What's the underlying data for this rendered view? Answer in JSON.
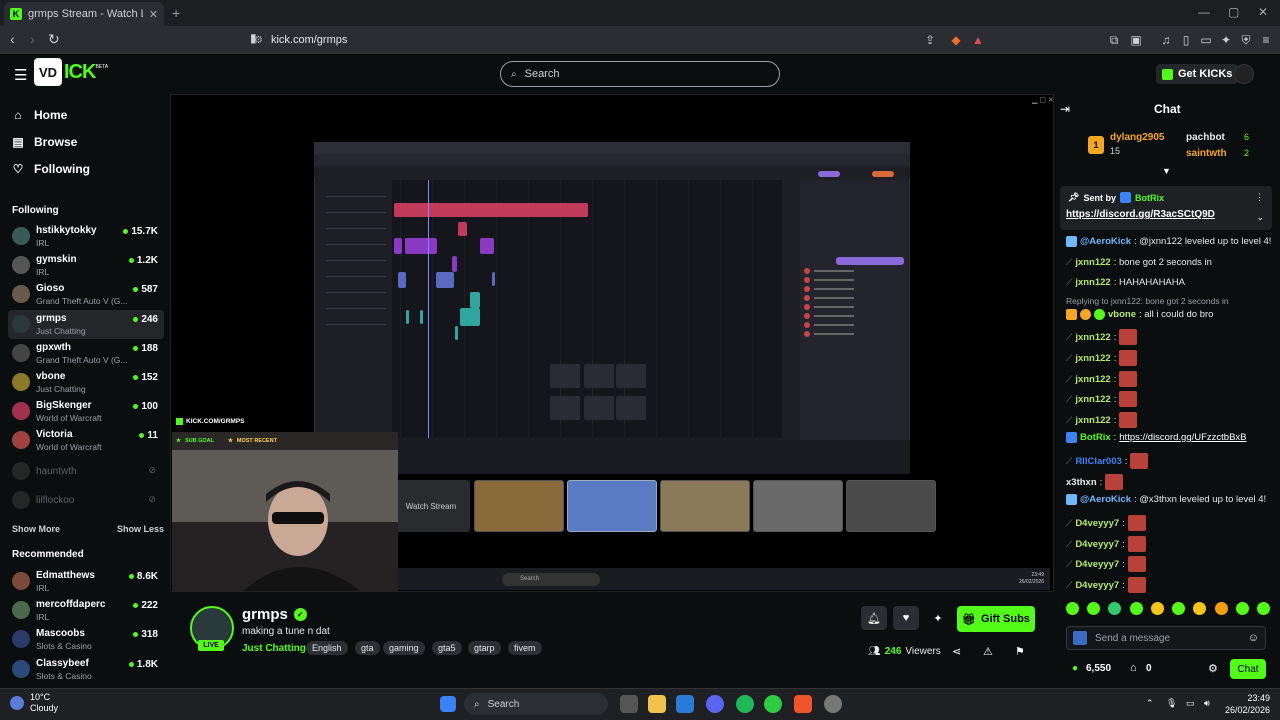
{
  "browser": {
    "tab_title": "grmps Stream - Watch Live o",
    "url": "kick.com/grmps",
    "favicon_letter": "K"
  },
  "header": {
    "logo_text": "ICK",
    "logo_mark": "VD",
    "beta": "BETA",
    "search_placeholder": "Search",
    "get_kicks": "Get KICKs"
  },
  "sidebar": {
    "nav": [
      {
        "label": "Home",
        "icon": "home-icon"
      },
      {
        "label": "Browse",
        "icon": "browse-icon"
      },
      {
        "label": "Following",
        "icon": "heart-icon"
      }
    ],
    "following_heading": "Following",
    "following": [
      {
        "name": "hstikkytokky",
        "category": "IRL",
        "viewers": "15.7K",
        "color": "#3a5a5a"
      },
      {
        "name": "gymskin",
        "category": "IRL",
        "viewers": "1.2K",
        "color": "#555"
      },
      {
        "name": "Gioso",
        "category": "Grand Theft Auto V (G...",
        "viewers": "587",
        "color": "#6a5a4a"
      },
      {
        "name": "grmps",
        "category": "Just Chatting",
        "viewers": "246",
        "color": "#2a3a3a"
      },
      {
        "name": "gpxwth",
        "category": "Grand Theft Auto V (G...",
        "viewers": "188",
        "color": "#444"
      },
      {
        "name": "vbone",
        "category": "Just Chatting",
        "viewers": "152",
        "color": "#8a7a2a"
      },
      {
        "name": "BigSkenger",
        "category": "World of Warcraft",
        "viewers": "100",
        "color": "#a03050"
      },
      {
        "name": "Victoria",
        "category": "World of Warcraft",
        "viewers": "11",
        "color": "#a04040"
      }
    ],
    "offline": [
      "hauntwth",
      "lilflockoo"
    ],
    "show_more": "Show More",
    "show_less": "Show Less",
    "recommended_heading": "Recommended",
    "recommended": [
      {
        "name": "Edmatthews",
        "category": "IRL",
        "viewers": "8.6K",
        "color": "#7a4a3a"
      },
      {
        "name": "mercoffdaperc",
        "category": "IRL",
        "viewers": "222",
        "color": "#4a6a4a"
      },
      {
        "name": "Mascoobs",
        "category": "Slots & Casino",
        "viewers": "318",
        "color": "#2a3a6a"
      },
      {
        "name": "Classybeef",
        "category": "Slots & Casino",
        "viewers": "1.8K",
        "color": "#2a4a7a"
      }
    ]
  },
  "video": {
    "overlay_text": "KICK.COM/GRMPS",
    "sub_goal": "SUB GOAL",
    "most_recent": "MOST RECENT",
    "watch_stream": "Watch Stream",
    "inner_taskbar_search": "Search",
    "inner_clock_time": "23:49",
    "inner_clock_date": "26/02/2026"
  },
  "stream": {
    "channel": "grmps",
    "title": "making a tune n dat",
    "category": "Just Chatting",
    "tags": [
      "English",
      "gta",
      "gaming",
      "gta5",
      "gtarp",
      "fivem"
    ],
    "live": "LIVE",
    "gift_subs": "Gift Subs",
    "viewers": "246",
    "viewers_label": "Viewers"
  },
  "chat": {
    "title": "Chat",
    "leaderboard": [
      {
        "name": "dylang2905",
        "count": "15",
        "color": "#f5a623"
      },
      {
        "name": "pachbot",
        "count": "6",
        "color": "#e6e8ea"
      },
      {
        "name": "saintwth",
        "count": "2",
        "color": "#f5a623"
      }
    ],
    "rank": "1",
    "pinned": {
      "sent_by": "Sent by",
      "author": "BotRix",
      "link": "https://discord.gg/R3acSCtQ9D"
    },
    "messages": [
      {
        "user": "@AeroKick",
        "text": ": @jxnn122 leveled up to level 4!",
        "color": "#6fb8ff"
      },
      {
        "user": "jxnn122",
        "text": ": bone got 2 seconds in",
        "color": "#b5e86a"
      },
      {
        "user": "jxnn122",
        "text": ": HAHAHAHAHA",
        "color": "#b5e86a"
      },
      {
        "user": "vbone",
        "text": ": all i could do bro",
        "color": "#b5e86a"
      },
      {
        "user": "jxnn122",
        "text": ":",
        "color": "#b5e86a"
      },
      {
        "user": "jxnn122",
        "text": ":",
        "color": "#b5e86a"
      },
      {
        "user": "jxnn122",
        "text": ":",
        "color": "#b5e86a"
      },
      {
        "user": "jxnn122",
        "text": ":",
        "color": "#b5e86a"
      },
      {
        "user": "jxnn122",
        "text": ":",
        "color": "#b5e86a"
      },
      {
        "user": "BotRix",
        "text": ": ",
        "link": "https://discord.gg/UFzzctbBxB",
        "color": "#53fc18"
      },
      {
        "user": "RllClar003",
        "text": ":",
        "color": "#3b82f6"
      },
      {
        "user": "x3thxn",
        "text": ":",
        "color": "#e6e8ea"
      },
      {
        "user": "@AeroKick",
        "text": ": @x3thxn leveled up to level 4!",
        "color": "#6fb8ff"
      },
      {
        "user": "D4veyyy7",
        "text": ":",
        "color": "#b5e86a"
      },
      {
        "user": "D4veyyy7",
        "text": ":",
        "color": "#b5e86a"
      },
      {
        "user": "D4veyyy7",
        "text": ":",
        "color": "#b5e86a"
      },
      {
        "user": "D4veyyy7",
        "text": ":",
        "color": "#b5e86a"
      }
    ],
    "reply_hint": "Replying to jxnn122: bone got 2 seconds in",
    "placeholder": "Send a message",
    "kicks_balance": "6,550",
    "gift_count": "0",
    "send_label": "Chat"
  },
  "taskbar": {
    "temp": "10°C",
    "weather": "Cloudy",
    "search": "Search",
    "time": "23:49",
    "date": "26/02/2026"
  },
  "colors": {
    "accent": "#53fc18",
    "background": "#0b0e0f"
  }
}
